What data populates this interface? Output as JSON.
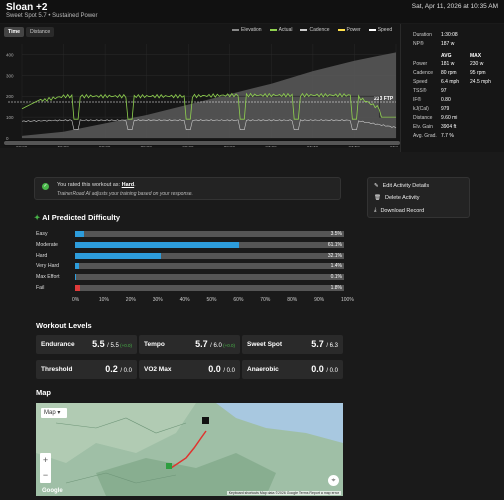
{
  "header": {
    "title": "Sloan +2",
    "subtitle": "Sweet Spot 5.7 • Sustained Power",
    "date": "Sat, Apr 11, 2026 at 10:35 AM"
  },
  "chart": {
    "tabs": [
      "Time",
      "Distance"
    ],
    "legend": [
      {
        "label": "Elevation",
        "color": "#888888"
      },
      {
        "label": "Actual",
        "color": "#8fd14f"
      },
      {
        "label": "Cadence",
        "color": "#cccccc"
      },
      {
        "label": "Power",
        "color": "#ffe14d"
      },
      {
        "label": "Speed",
        "color": "#ffffff"
      }
    ],
    "ftp_label": "233 FTP",
    "y_ticks": [
      "400",
      "300",
      "200",
      "100",
      "0"
    ],
    "x_ticks": [
      "00:00",
      "10:00",
      "20:00",
      "30:00",
      "40:00",
      "50:00",
      "01:00",
      "01:10",
      "01:20",
      "01:30"
    ]
  },
  "chart_data": {
    "type": "line",
    "x": [
      0,
      10,
      20,
      30,
      40,
      50,
      60,
      70,
      80,
      90
    ],
    "xlabel": "",
    "ylabel": "",
    "ylim": [
      0,
      450
    ],
    "series": [
      {
        "name": "Elevation",
        "values": [
          10,
          30,
          70,
          110,
          160,
          210,
          260,
          320,
          370,
          410
        ]
      },
      {
        "name": "Actual",
        "values": [
          160,
          200,
          200,
          200,
          200,
          205,
          205,
          205,
          205,
          100
        ]
      },
      {
        "name": "Cadence",
        "values": [
          80,
          85,
          85,
          85,
          85,
          85,
          85,
          85,
          85,
          50
        ]
      }
    ]
  },
  "stats": {
    "duration_label": "Duration",
    "duration": "1:30:08",
    "np_label": "NP®",
    "np": "187 w",
    "avg_label": "AVG",
    "max_label": "MAX",
    "power_label": "Power",
    "power_avg": "181 w",
    "power_max": "230 w",
    "cadence_label": "Cadence",
    "cadence_avg": "80 rpm",
    "cadence_max": "95 rpm",
    "speed_label": "Speed",
    "speed_avg": "6.4 mph",
    "speed_max": "24.5 mph",
    "tss_label": "TSS®",
    "tss": "97",
    "if_label": "IF®",
    "if": "0.80",
    "kj_label": "kJ(Cal)",
    "kj": "979",
    "distance_label": "Distance",
    "distance": "9.60 mi",
    "elev_label": "Elv. Gain",
    "elev": "3904 ft",
    "grad_label": "Avg. Grad.",
    "grad": "7.7 %"
  },
  "rated": {
    "line1_prefix": "You rated this workout as: ",
    "rating": "Hard",
    "line1_suffix": ".",
    "line2": "TrainerRoad AI adjusts your training based on your response."
  },
  "menu": {
    "edit": "Edit Activity Details",
    "delete": "Delete Activity",
    "download": "Download Record"
  },
  "difficulty": {
    "title": "AI Predicted Difficulty",
    "rows": [
      {
        "label": "Easy",
        "pct": "3.5%",
        "value": 3.5,
        "color": "#2d9cdb"
      },
      {
        "label": "Moderate",
        "pct": "61.1%",
        "value": 61.1,
        "color": "#2d9cdb"
      },
      {
        "label": "Hard",
        "pct": "32.1%",
        "value": 32.1,
        "color": "#2d9cdb"
      },
      {
        "label": "Very Hard",
        "pct": "1.4%",
        "value": 1.4,
        "color": "#2d9cdb"
      },
      {
        "label": "Max Effort",
        "pct": "0.1%",
        "value": 0.1,
        "color": "#2d9cdb"
      },
      {
        "label": "Fail",
        "pct": "1.8%",
        "value": 1.8,
        "color": "#e03b3b"
      }
    ],
    "axis": [
      "0%",
      "10%",
      "20%",
      "30%",
      "40%",
      "50%",
      "60%",
      "70%",
      "80%",
      "90%",
      "100%"
    ]
  },
  "levels": {
    "title": "Workout Levels",
    "items": [
      {
        "name": "Endurance",
        "value": "5.5",
        "max": "/ 5.5",
        "delta": "(+0.0)"
      },
      {
        "name": "Tempo",
        "value": "5.7",
        "max": "/ 6.0",
        "delta": "(+0.0)"
      },
      {
        "name": "Sweet Spot",
        "value": "5.7",
        "max": "/ 6.3",
        "delta": ""
      },
      {
        "name": "Threshold",
        "value": "0.2",
        "max": "/ 0.0",
        "delta": ""
      },
      {
        "name": "VO2 Max",
        "value": "0.0",
        "max": "/ 0.0",
        "delta": ""
      },
      {
        "name": "Anaerobic",
        "value": "0.0",
        "max": "/ 0.0",
        "delta": ""
      }
    ]
  },
  "map": {
    "title": "Map",
    "type_button": "Map",
    "footer": "Keyboard shortcuts  Map data ©2026 Google  Terms  Report a map error",
    "logo": "Google"
  }
}
